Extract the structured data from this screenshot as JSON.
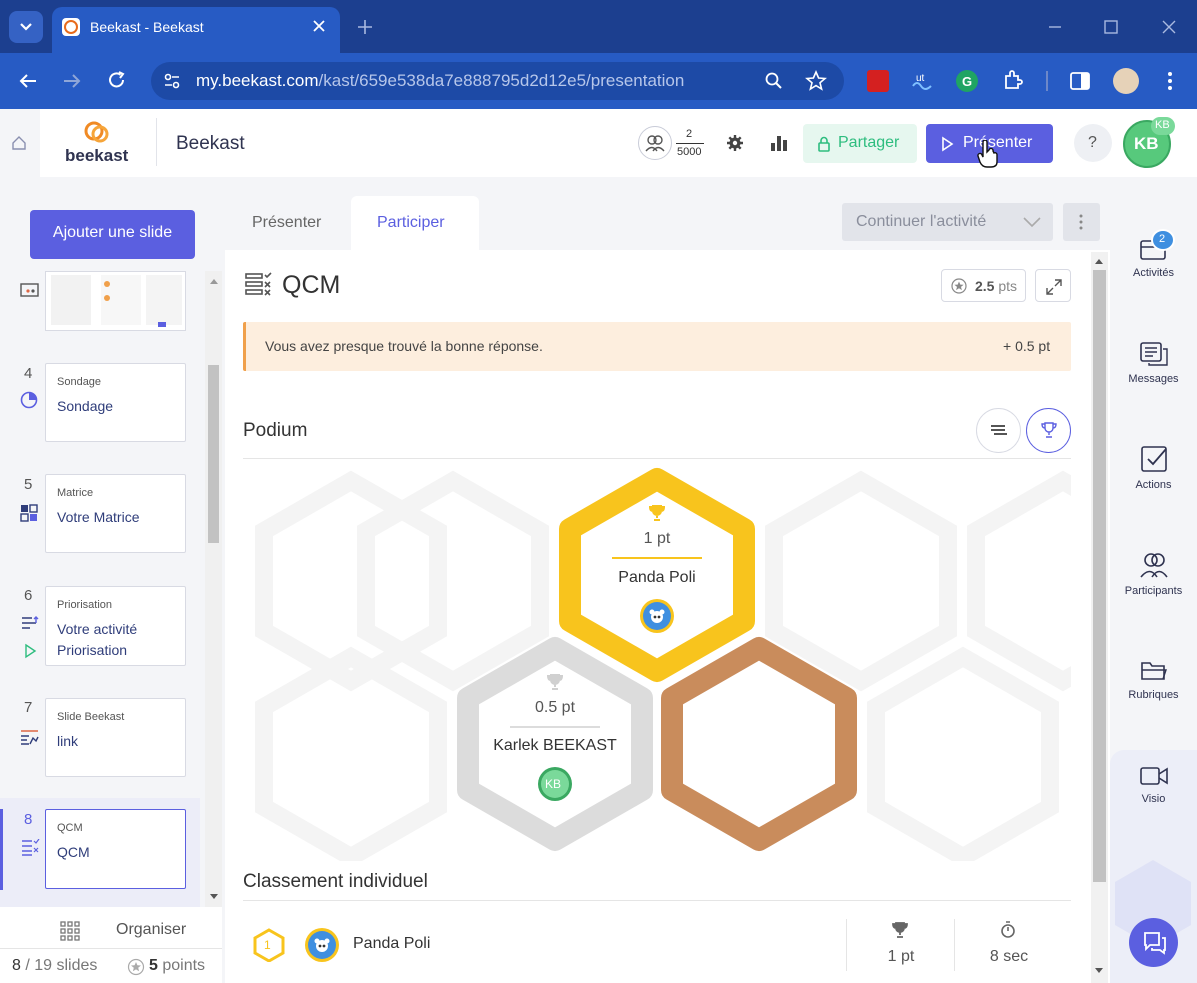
{
  "browser": {
    "tab_title": "Beekast - Beekast",
    "url_host": "my.beekast.com",
    "url_path": "/kast/659e538da7e888795d2d12e5/presentation"
  },
  "header": {
    "logo_text": "beekast",
    "title": "Beekast",
    "participants_count": "2",
    "participants_max": "5000",
    "share_label": "Partager",
    "present_label": "Présenter",
    "help_label": "?",
    "avatar_initials": "KB",
    "avatar_badge": "KB"
  },
  "sidebar": {
    "add_slide_label": "Ajouter une slide",
    "slides": [
      {
        "num": "4",
        "type": "Sondage",
        "title": "Sondage"
      },
      {
        "num": "5",
        "type": "Matrice",
        "title": "Votre Matrice"
      },
      {
        "num": "6",
        "type": "Priorisation",
        "title": "Votre activité Priorisation"
      },
      {
        "num": "7",
        "type": "Slide Beekast",
        "title": "link"
      },
      {
        "num": "8",
        "type": "QCM",
        "title": "QCM"
      }
    ],
    "organize_label": "Organiser",
    "slides_count": "8",
    "slides_total": "/ 19 slides",
    "points_value": "5",
    "points_label": "points"
  },
  "main": {
    "tabs": [
      "Présenter",
      "Participer"
    ],
    "continue_label": "Continuer l'activité",
    "activity_title": "QCM",
    "points_badge_value": "2.5",
    "points_badge_unit": "pts",
    "alert_text": "Vous avez presque trouvé la bonne réponse.",
    "alert_points": "+ 0.5 pt",
    "podium_title": "Podium",
    "first": {
      "points": "1 pt",
      "name": "Panda Poli"
    },
    "second": {
      "points": "0.5 pt",
      "name": "Karlek BEEKAST",
      "initials": "KB"
    },
    "ranking_title": "Classement individuel",
    "ranking": [
      {
        "rank": "1",
        "name": "Panda Poli",
        "points": "1 pt",
        "time": "8 sec"
      }
    ]
  },
  "rightbar": {
    "items": [
      {
        "label": "Activités",
        "badge": "2"
      },
      {
        "label": "Messages"
      },
      {
        "label": "Actions"
      },
      {
        "label": "Participants"
      },
      {
        "label": "Rubriques"
      },
      {
        "label": "Visio"
      }
    ]
  },
  "colors": {
    "browser_dark": "#1c3f8f",
    "browser_mid": "#275bc4",
    "accent": "#5b5fe0",
    "share_green": "#2ebd7f",
    "gold": "#f8c41d",
    "silver": "#dcdcdc",
    "bronze": "#c98c5c",
    "alert_bg": "#fdeede",
    "alert_border": "#f0a04b"
  }
}
